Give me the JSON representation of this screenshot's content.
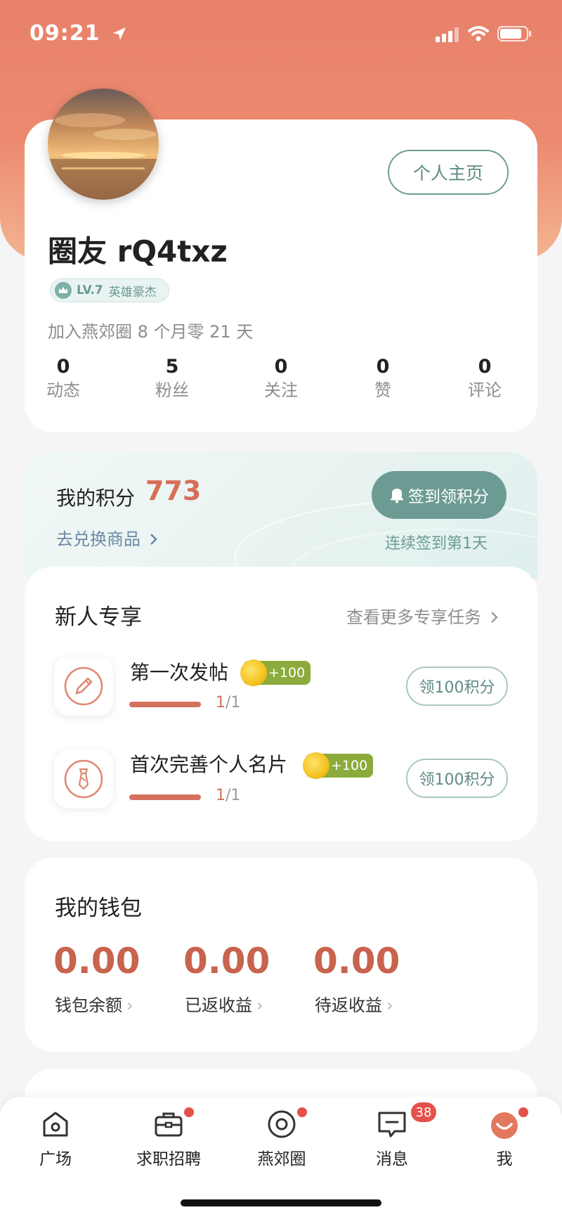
{
  "status_bar": {
    "time": "09:21"
  },
  "profile": {
    "home_button": "个人主页",
    "username": "圈友 rQ4txz",
    "level": "LV.7",
    "level_title": "英雄豪杰",
    "join_text": "加入燕郊圈 8 个月零 21 天",
    "stats": [
      {
        "value": "0",
        "label": "动态"
      },
      {
        "value": "5",
        "label": "粉丝"
      },
      {
        "value": "0",
        "label": "关注"
      },
      {
        "value": "0",
        "label": "赞"
      },
      {
        "value": "0",
        "label": "评论"
      }
    ]
  },
  "points": {
    "title": "我的积分",
    "value": "773",
    "redeem_link": "去兑换商品",
    "signin_button": "签到领积分",
    "signin_streak": "连续签到第1天"
  },
  "newbie": {
    "title": "新人专享",
    "more_link": "查看更多专享任务",
    "tasks": [
      {
        "title": "第一次发帖",
        "reward": "+100",
        "progress_current": "1",
        "progress_total": "/1",
        "progress_fraction": 1,
        "button": "领100积分",
        "icon": "pencil-icon"
      },
      {
        "title": "首次完善个人名片",
        "reward": "+100",
        "progress_current": "1",
        "progress_total": "/1",
        "progress_fraction": 1,
        "button": "领100积分",
        "icon": "tie-icon"
      }
    ]
  },
  "wallet": {
    "title": "我的钱包",
    "items": [
      {
        "value": "0.00",
        "label": "钱包余额"
      },
      {
        "value": "0.00",
        "label": "已返收益"
      },
      {
        "value": "0.00",
        "label": "待返收益"
      }
    ]
  },
  "tabbar": {
    "tabs": [
      {
        "label": "广场",
        "icon": "home-icon"
      },
      {
        "label": "求职招聘",
        "icon": "briefcase-icon"
      },
      {
        "label": "燕郊圈",
        "icon": "circle-icon"
      },
      {
        "label": "消息",
        "icon": "message-icon"
      },
      {
        "label": "我",
        "icon": "me-icon"
      }
    ],
    "message_badge": "38"
  },
  "colors": {
    "header_gradient_top": "#e8806a",
    "accent_teal": "#6c9b93",
    "accent_red": "#d86e57",
    "badge_red": "#e4504b"
  }
}
